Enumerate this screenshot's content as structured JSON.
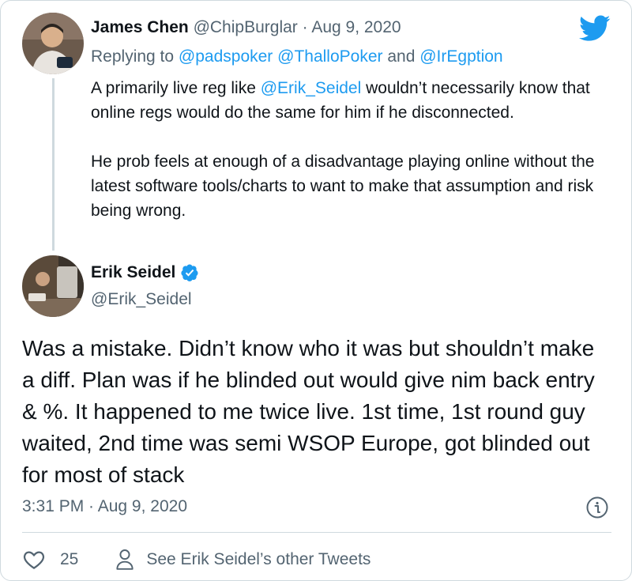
{
  "reply": {
    "author_name": "James Chen",
    "author_handle": "@ChipBurglar",
    "separator": " · ",
    "date": "Aug 9, 2020",
    "replying_prefix": "Replying to ",
    "replying_to_1": "@padspoker",
    "replying_to_2": "@ThalloPoker",
    "replying_and": " and ",
    "replying_to_3": "@IrEgption",
    "text_p1_before": "A primarily live reg like ",
    "text_p1_mention": "@Erik_Seidel",
    "text_p1_after": " wouldn’t necessarily know that online regs would do the same for him if he disconnected.",
    "text_p2": "He prob feels at enough of a disadvantage playing online without the latest software tools/charts to want to make that assumption and risk being wrong."
  },
  "tweet": {
    "author_name": "Erik Seidel",
    "author_handle": "@Erik_Seidel",
    "text": "Was a mistake. Didn’t know who it was but shouldn’t make a diff. Plan was if he blinded out would give nim back entry & %. It happened to me twice live. 1st time, 1st round guy waited, 2nd time was semi WSOP Europe, got blinded out for most of stack",
    "time": "3:31 PM",
    "separator": " · ",
    "date": "Aug 9, 2020"
  },
  "actions": {
    "like_count": "25",
    "other_tweets_label": "See Erik Seidel’s other Tweets"
  },
  "icons": {
    "logo": "twitter-bird-icon",
    "verified": "verified-badge-icon",
    "info": "info-icon",
    "like": "heart-icon",
    "profile": "user-icon"
  },
  "colors": {
    "accent": "#1d9bf0",
    "text": "#0f1419",
    "muted": "#536471",
    "border": "#cfd9de"
  }
}
